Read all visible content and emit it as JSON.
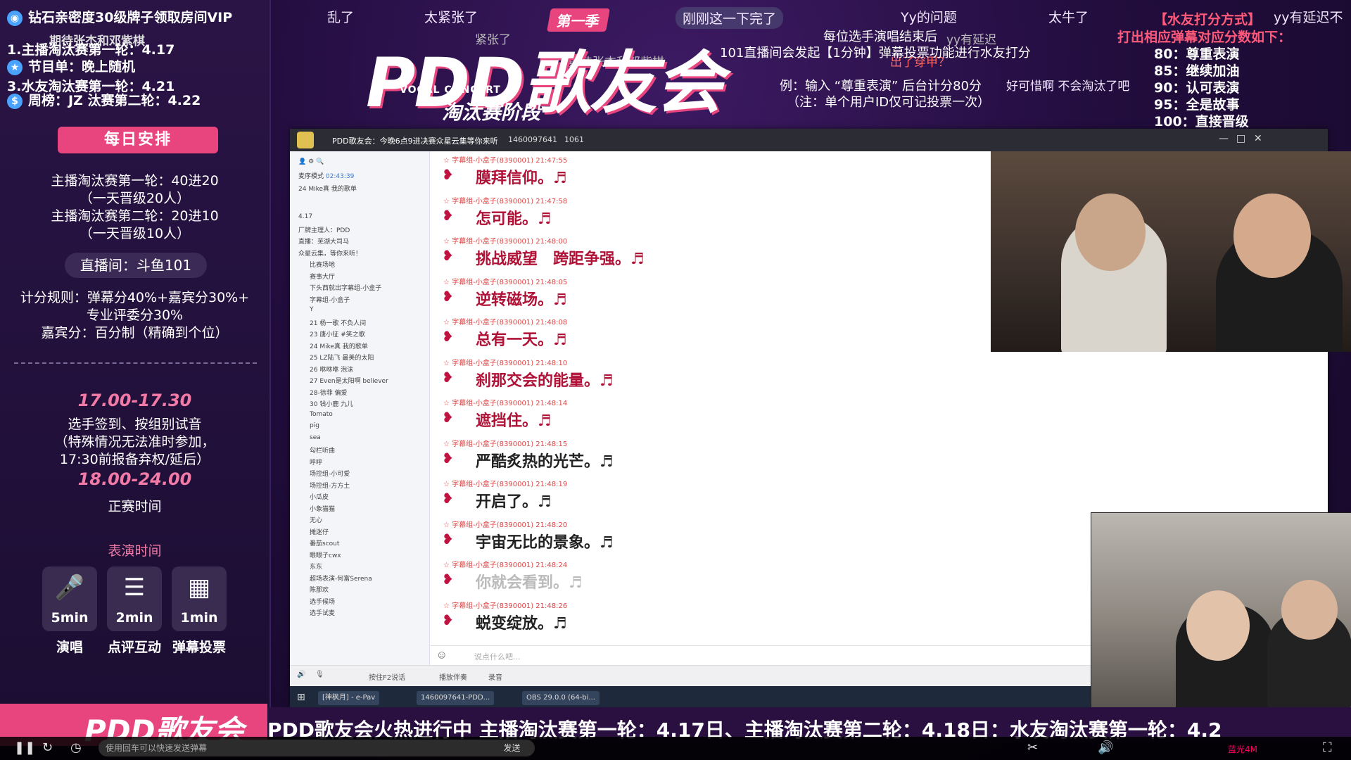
{
  "left_panel": {
    "vip_line": "钻石亲密度30级牌子领取房间VIP",
    "pinned_user": "期待张杰和邓紫棋",
    "info_rows": [
      {
        "text": "1.主播淘汰赛第一轮：4.17"
      },
      {
        "text": "节目单：晚上随机"
      },
      {
        "text": "3.水友淘汰赛第一轮：4.21"
      },
      {
        "text": "周榜：JZ  汰赛第二轮：4.22"
      }
    ],
    "side_dates": [
      "4.17",
      "4.18",
      "4.21",
      "4.22"
    ],
    "schedule_button": "每日安排",
    "schedule_lines": [
      "主播淘汰赛第一轮：40进20",
      "（一天晋级20人）",
      "主播淘汰赛第二轮：20进10",
      "（一天晋级10人）"
    ],
    "room_label": "直播间：斗鱼101",
    "scoring_lines": [
      "计分规则：弹幕分40%+嘉宾分30%+",
      "专业评委分30%",
      "嘉宾分：百分制（精确到个位）"
    ],
    "time1": "17.00-17.30",
    "time1_lines": [
      "选手签到、按组别试音",
      "（特殊情况无法准时参加，",
      "17:30前报备弃权/延后）"
    ],
    "time2": "18.00-24.00",
    "time2_label": "正赛时间",
    "perf_title": "表演时间",
    "perf_items": [
      {
        "icon": "mic-icon",
        "duration": "5min",
        "label": "演唱"
      },
      {
        "icon": "comment-icon",
        "duration": "2min",
        "label": "点评互动"
      },
      {
        "icon": "vote-icon",
        "duration": "1min",
        "label": "弹幕投票"
      }
    ]
  },
  "header": {
    "danmu": [
      "乱了",
      "太紧张了",
      "刚刚这一下完了",
      "Yy的问题",
      "太牛了",
      "yy有延迟不",
      "紧张了",
      "yy有延迟",
      "出了穿甲？",
      "期待张杰和邓紫棋",
      "好可惜啊 不会淘汰了吧"
    ],
    "logo_tag": "第一季",
    "logo_main": "PDD歌友会",
    "logo_sub": "VOCAL CONCERT",
    "logo_stage": "淘汰赛阶段",
    "rule_lines": [
      "每位选手演唱结束后",
      "101直播间会发起【1分钟】弹幕投票功能进行水友打分",
      "例：输入 “尊重表演” 后台计分80分",
      "（注：单个用户ID仅可记投票一次）"
    ],
    "score_title": "【水友打分方式】",
    "score_sub": "打出相应弹幕对应分数如下：",
    "score_items": [
      "80：尊重表演",
      "85：继续加油",
      "90：认可表演",
      "95：全是故事",
      "100：直接晋级"
    ]
  },
  "window": {
    "title": "PDD歌友会：今晚6点9进决赛众星云集等你来听",
    "room_id": "1460097641",
    "viewers": "1061",
    "tree_top": "24 Mike真 我的歌单",
    "tree_mode": "麦序模式",
    "tree_timer": "02:43:39",
    "tree_items": [
      "4.17",
      "厂牌主理人：PDD",
      "直播：芜湖大司马",
      "众星云集，等你来听！",
      "比赛场地",
      "赛事大厅",
      "下头西就出字幕组-小盒子",
      "字幕组-小盒子",
      "Y",
      "21 杨一歌 不负人间",
      "23 唐小征 #笑之歌",
      "24 Mike真 我的歌单",
      "25 LZ陆飞 最美的太阳",
      "26 咻咻咻 泡沫",
      "27 Even是太阳啊 believer",
      "28-徐菲 偏爱",
      "30 钱小鹿 九儿",
      "Tomato",
      "pig",
      "sea",
      "勾栏听曲",
      "呼呼",
      "场控组-小可爱",
      "场控组-方方土",
      "小瓜皮",
      "小象猫猫",
      "无心",
      "摊迷仔",
      "番茄scout",
      "眼眼子cwx",
      "东东",
      "超场表演-何富Serena",
      "陈那欢",
      "选手候场",
      "选手试麦"
    ],
    "messages": [
      {
        "name": "字幕组-小盒子(8390001)",
        "time": "21:47:55",
        "text": "膜拜信仰。♬"
      },
      {
        "name": "字幕组-小盒子(8390001)",
        "time": "21:47:58",
        "text": "怎可能。♬"
      },
      {
        "name": "字幕组-小盒子(8390001)",
        "time": "21:48:00",
        "text": "挑战威望　跨距争强。♬"
      },
      {
        "name": "字幕组-小盒子(8390001)",
        "time": "21:48:05",
        "text": "逆转磁场。♬"
      },
      {
        "name": "字幕组-小盒子(8390001)",
        "time": "21:48:08",
        "text": "总有一天。♬"
      },
      {
        "name": "字幕组-小盒子(8390001)",
        "time": "21:48:10",
        "text": "刹那交会的能量。♬"
      },
      {
        "name": "字幕组-小盒子(8390001)",
        "time": "21:48:14",
        "text": "遮挡住。♬"
      },
      {
        "name": "字幕组-小盒子(8390001)",
        "time": "21:48:15",
        "text": "严酷炙热的光芒。♬"
      },
      {
        "name": "字幕组-小盒子(8390001)",
        "time": "21:48:19",
        "text": "开启了。♬"
      },
      {
        "name": "字幕组-小盒子(8390001)",
        "time": "21:48:20",
        "text": "宇宙无比的景象。♬"
      },
      {
        "name": "字幕组-小盒子(8390001)",
        "time": "21:48:24",
        "text": "你就会看到。♬"
      },
      {
        "name": "字幕组-小盒子(8390001)",
        "time": "21:48:26",
        "text": "蜕变绽放。♬"
      }
    ],
    "composer_placeholder": "说点什么吧...",
    "bottom_items": [
      "按住F2说话",
      "播放伴奏",
      "录音"
    ],
    "taskbar_items": [
      "[神枫月] - e-Pav",
      "1460097641-PDD...",
      "OBS 29.0.0 (64-bi..."
    ]
  },
  "ticker": {
    "text": "PDD歌友会火热进行中 主播淘汰赛第一轮：4.17日、主播淘汰赛第二轮：4.18日：水友淘汰赛第一轮：4.2"
  },
  "player": {
    "danmu_placeholder": "使用回车可以快速发送弹幕",
    "send_label": "发送",
    "quality": "蓝光4M"
  },
  "colors": {
    "accent_pink": "#e8457f",
    "chat_red": "#b01237",
    "bg_purple": "#220d3e"
  }
}
